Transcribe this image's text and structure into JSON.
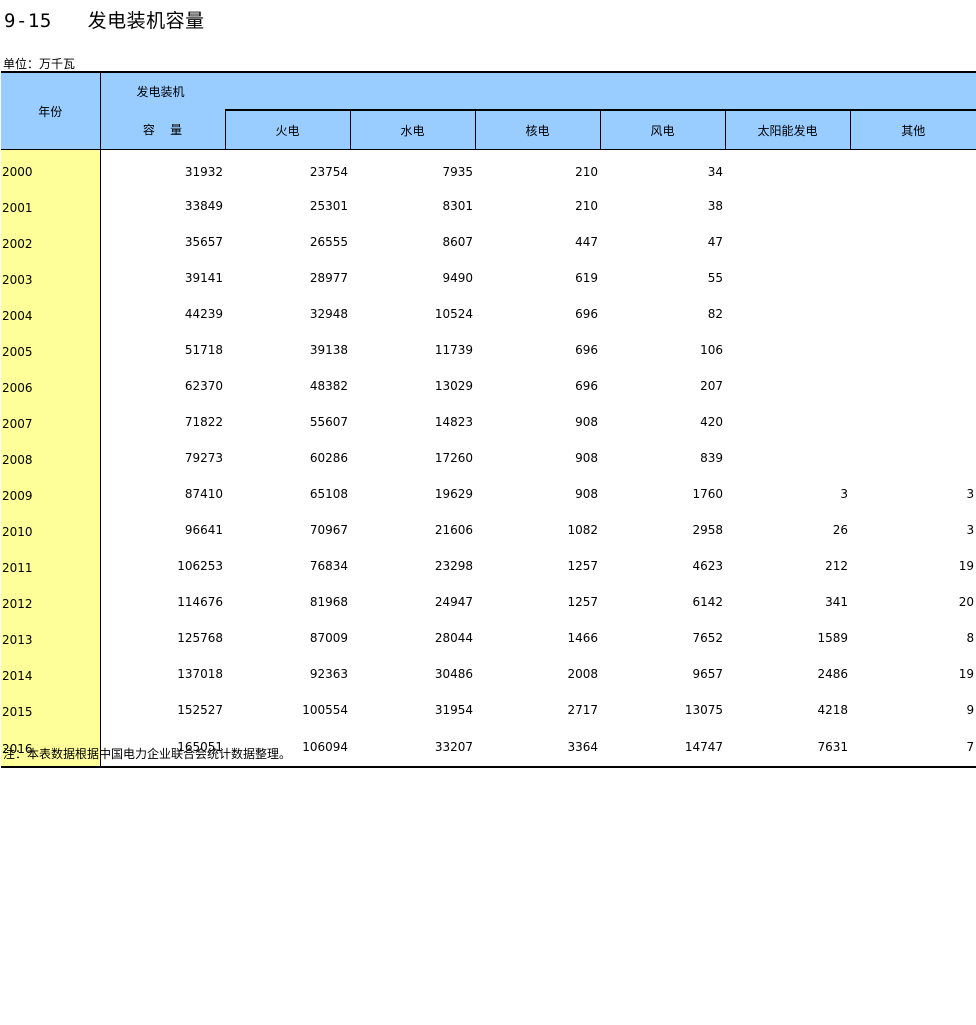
{
  "title": "9-15   发电装机容量",
  "unit": "单位：万千瓦",
  "header": {
    "year": "年份",
    "group": "发电装机",
    "total": "容    量",
    "thermal": "火电",
    "hydro": "水电",
    "nuclear": "核电",
    "wind": "风电",
    "solar": "太阳能发电",
    "other": "其他"
  },
  "rows": [
    {
      "year": "2000",
      "total": "31932",
      "thermal": "23754",
      "hydro": "7935",
      "nuclear": "210",
      "wind": "34",
      "solar": "",
      "other": ""
    },
    {
      "year": "2001",
      "total": "33849",
      "thermal": "25301",
      "hydro": "8301",
      "nuclear": "210",
      "wind": "38",
      "solar": "",
      "other": ""
    },
    {
      "year": "2002",
      "total": "35657",
      "thermal": "26555",
      "hydro": "8607",
      "nuclear": "447",
      "wind": "47",
      "solar": "",
      "other": ""
    },
    {
      "year": "2003",
      "total": "39141",
      "thermal": "28977",
      "hydro": "9490",
      "nuclear": "619",
      "wind": "55",
      "solar": "",
      "other": ""
    },
    {
      "year": "2004",
      "total": "44239",
      "thermal": "32948",
      "hydro": "10524",
      "nuclear": "696",
      "wind": "82",
      "solar": "",
      "other": ""
    },
    {
      "year": "2005",
      "total": "51718",
      "thermal": "39138",
      "hydro": "11739",
      "nuclear": "696",
      "wind": "106",
      "solar": "",
      "other": ""
    },
    {
      "year": "2006",
      "total": "62370",
      "thermal": "48382",
      "hydro": "13029",
      "nuclear": "696",
      "wind": "207",
      "solar": "",
      "other": ""
    },
    {
      "year": "2007",
      "total": "71822",
      "thermal": "55607",
      "hydro": "14823",
      "nuclear": "908",
      "wind": "420",
      "solar": "",
      "other": ""
    },
    {
      "year": "2008",
      "total": "79273",
      "thermal": "60286",
      "hydro": "17260",
      "nuclear": "908",
      "wind": "839",
      "solar": "",
      "other": ""
    },
    {
      "year": "2009",
      "total": "87410",
      "thermal": "65108",
      "hydro": "19629",
      "nuclear": "908",
      "wind": "1760",
      "solar": "3",
      "other": "3"
    },
    {
      "year": "2010",
      "total": "96641",
      "thermal": "70967",
      "hydro": "21606",
      "nuclear": "1082",
      "wind": "2958",
      "solar": "26",
      "other": "3"
    },
    {
      "year": "2011",
      "total": "106253",
      "thermal": "76834",
      "hydro": "23298",
      "nuclear": "1257",
      "wind": "4623",
      "solar": "212",
      "other": "19"
    },
    {
      "year": "2012",
      "total": "114676",
      "thermal": "81968",
      "hydro": "24947",
      "nuclear": "1257",
      "wind": "6142",
      "solar": "341",
      "other": "20"
    },
    {
      "year": "2013",
      "total": "125768",
      "thermal": "87009",
      "hydro": "28044",
      "nuclear": "1466",
      "wind": "7652",
      "solar": "1589",
      "other": "8"
    },
    {
      "year": "2014",
      "total": "137018",
      "thermal": "92363",
      "hydro": "30486",
      "nuclear": "2008",
      "wind": "9657",
      "solar": "2486",
      "other": "19"
    },
    {
      "year": "2015",
      "total": "152527",
      "thermal": "100554",
      "hydro": "31954",
      "nuclear": "2717",
      "wind": "13075",
      "solar": "4218",
      "other": "9"
    },
    {
      "year": "2016",
      "total": "165051",
      "thermal": "106094",
      "hydro": "33207",
      "nuclear": "3364",
      "wind": "14747",
      "solar": "7631",
      "other": "7"
    }
  ],
  "note": "注：本表数据根据中国电力企业联合会统计数据整理。",
  "colors": {
    "header_bg": "#99ccff",
    "year_col_bg": "#ffff99"
  }
}
